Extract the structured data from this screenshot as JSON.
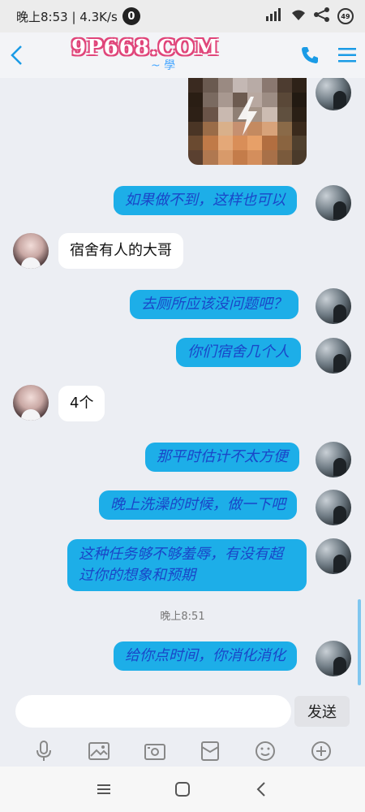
{
  "status_bar": {
    "time_speed": "晚上8:53 | 4.3K/s",
    "app_badge": "0",
    "battery": "49"
  },
  "header": {
    "title": "9P668.COM",
    "subtitle": "~ 學"
  },
  "messages": [
    {
      "side": "out",
      "text": "如果做不到，这样也可以"
    },
    {
      "side": "in",
      "text": "宿舍有人的大哥"
    },
    {
      "side": "out",
      "text": "去厕所应该没问题吧？"
    },
    {
      "side": "out",
      "text": "你们宿舍几个人"
    },
    {
      "side": "in",
      "text": "4个"
    },
    {
      "side": "out",
      "text": "那平时估计不太方便"
    },
    {
      "side": "out",
      "text": "晚上洗澡的时候，做一下吧"
    },
    {
      "side": "out",
      "text": "这种任务够不够羞辱，有没有超过你的想象和预期"
    },
    {
      "side": "out",
      "text": "给你点时间，你消化消化"
    }
  ],
  "timestamp": "晚上8:51",
  "input": {
    "placeholder": "",
    "value": ""
  },
  "send_label": "发送",
  "toolbar_icons": [
    "mic-icon",
    "image-icon",
    "camera-icon",
    "red-envelope-icon",
    "emoji-icon",
    "plus-icon"
  ],
  "nav_icons": [
    "menu-icon",
    "home-icon",
    "back-icon"
  ],
  "colors": {
    "accent": "#1a9be6",
    "bubble_out": "#1daee8",
    "bubble_out_text": "#1a46c8"
  }
}
